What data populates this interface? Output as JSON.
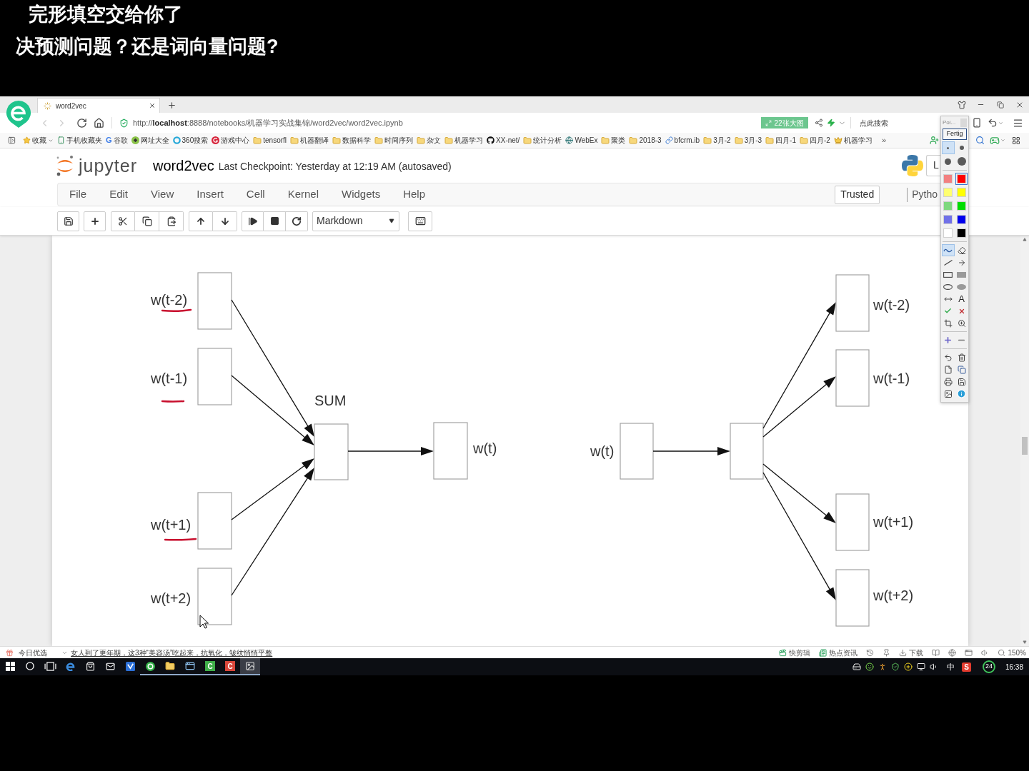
{
  "subtitles": [
    "完形填空交给你了",
    "决预测问题？还是词向量问题?"
  ],
  "browser": {
    "tabs": [
      {
        "title": "word2vec",
        "selected": true
      }
    ],
    "nav": {
      "back": {
        "disabled": true
      },
      "forward": {
        "disabled": true
      }
    },
    "url": "http://**localhost**:8888/notebooks/机器学习实战集锦/word2vec/word2vec.ipynb",
    "image_badge": "22张大图",
    "search": {
      "placeholder": "点此搜索"
    },
    "bookmarks": [
      {
        "label": "收藏",
        "kind": "favorites"
      },
      {
        "label": "手机收藏夹",
        "kind": "mobile"
      },
      {
        "label": "谷歌",
        "kind": "letter",
        "glyph": "G"
      },
      {
        "label": "网址大全",
        "kind": "site"
      },
      {
        "label": "360搜索",
        "kind": "ring"
      },
      {
        "label": "游戏中心",
        "kind": "game"
      },
      {
        "label": "tensorfl",
        "kind": "folder"
      },
      {
        "label": "机器翻译",
        "kind": "folder"
      },
      {
        "label": "数据科学",
        "kind": "folder"
      },
      {
        "label": "时间序列",
        "kind": "folder"
      },
      {
        "label": "杂文",
        "kind": "folder"
      },
      {
        "label": "机器学习",
        "kind": "folder"
      },
      {
        "label": "XX-net/",
        "kind": "github"
      },
      {
        "label": "统计分析",
        "kind": "folder"
      },
      {
        "label": "WebEx",
        "kind": "globe"
      },
      {
        "label": "聚类",
        "kind": "folder"
      },
      {
        "label": "2018-3",
        "kind": "folder"
      },
      {
        "label": "bfcrm.ib",
        "kind": "link"
      },
      {
        "label": "3月-2",
        "kind": "folder"
      },
      {
        "label": "3月-3",
        "kind": "folder"
      },
      {
        "label": "四月-1",
        "kind": "folder"
      },
      {
        "label": "四月-2",
        "kind": "folder"
      },
      {
        "label": "机器学习",
        "kind": "crown"
      }
    ],
    "more_bookmarks": "»"
  },
  "notebook": {
    "logo_text": "jupyter",
    "title": "word2vec",
    "checkpoint": "Last Checkpoint: Yesterday at 12:19 AM (autosaved)",
    "logout_button": "L",
    "menu": [
      "File",
      "Edit",
      "View",
      "Insert",
      "Cell",
      "Kernel",
      "Widgets",
      "Help"
    ],
    "trusted_button": "Trusted",
    "kernel": "Pytho",
    "cell_type": "Markdown",
    "diagram": {
      "left_network": {
        "inputs": [
          {
            "label": "w(t-2)",
            "underlined": true
          },
          {
            "label": "w(t-1)",
            "underlined": true
          },
          {
            "label": "w(t+1)",
            "underlined": true
          },
          {
            "label": "w(t+2)",
            "underlined": false
          }
        ],
        "sum_label": "SUM",
        "output_label": "w(t)"
      },
      "right_network": {
        "input_label": "w(t)",
        "outputs": [
          "w(t-2)",
          "w(t-1)",
          "w(t+1)",
          "w(t+2)"
        ]
      }
    }
  },
  "status_bar": {
    "picks_label": "今日优选",
    "headline": "女人到了更年期，这3种“美容汤”吃起来，抗氧化，皱纹悄悄平整",
    "right": [
      {
        "kind": "clip",
        "label": "快剪辑"
      },
      {
        "kind": "news",
        "label": "热点资讯"
      },
      {
        "kind": "history"
      },
      {
        "kind": "pin"
      },
      {
        "kind": "download",
        "label": "下载"
      },
      {
        "kind": "reader"
      },
      {
        "kind": "ie"
      },
      {
        "kind": "window"
      },
      {
        "kind": "sound"
      },
      {
        "kind": "zoom",
        "label": "150%"
      }
    ]
  },
  "taskbar": {
    "apps": [
      {
        "kind": "start",
        "open": false,
        "active": false
      },
      {
        "kind": "search",
        "open": false,
        "active": false
      },
      {
        "kind": "taskview",
        "open": false,
        "active": false
      },
      {
        "kind": "edge",
        "open": false,
        "active": false
      },
      {
        "kind": "store",
        "open": false,
        "active": false
      },
      {
        "kind": "mail",
        "open": false,
        "active": false
      },
      {
        "kind": "bird",
        "open": false,
        "active": false
      },
      {
        "kind": "browser",
        "open": true,
        "active": false
      },
      {
        "kind": "explorer",
        "open": true,
        "active": false
      },
      {
        "kind": "window",
        "open": true,
        "active": false
      },
      {
        "kind": "tile",
        "glyph": "C",
        "color": "#3fae49",
        "open": true,
        "active": false
      },
      {
        "kind": "tile",
        "glyph": "C",
        "color": "#d9473b",
        "open": true,
        "active": false
      },
      {
        "kind": "image",
        "open": true,
        "active": true
      }
    ],
    "tray": [
      {
        "kind": "disk"
      },
      {
        "kind": "smile"
      },
      {
        "kind": "figure"
      },
      {
        "kind": "shield"
      },
      {
        "kind": "plus"
      },
      {
        "kind": "network"
      },
      {
        "kind": "volume"
      }
    ],
    "ime": "中",
    "ime_tile": "S",
    "badge": "24",
    "clock": "16:38"
  },
  "palette": {
    "title": "Poi...",
    "done_button": "Fertig",
    "pen_sizes": [
      {
        "selected": true
      },
      {
        "selected": false
      },
      {
        "selected": false
      },
      {
        "selected": false
      }
    ],
    "colors": [
      {
        "color": "#f28080",
        "selected": false
      },
      {
        "color": "#ff0000",
        "selected": true
      },
      {
        "color": "#ffff70",
        "selected": false
      },
      {
        "color": "#ffff00",
        "selected": false
      },
      {
        "color": "#7ed87e",
        "selected": false
      },
      {
        "color": "#00dd00",
        "selected": false
      },
      {
        "color": "#7070e8",
        "selected": false
      },
      {
        "color": "#0000ee",
        "selected": false
      },
      {
        "color": "#ffffff",
        "selected": false
      },
      {
        "color": "#000000",
        "selected": false
      }
    ],
    "tools": [
      {
        "kind": "freehand",
        "selected": true
      },
      {
        "kind": "eraser",
        "selected": false
      },
      {
        "kind": "line",
        "selected": false
      },
      {
        "kind": "arrow",
        "selected": false
      },
      {
        "kind": "rectangle",
        "selected": false
      },
      {
        "kind": "filled-rectangle",
        "selected": false
      },
      {
        "kind": "ellipse",
        "selected": false
      },
      {
        "kind": "filled-ellipse",
        "selected": false
      },
      {
        "kind": "double-arrow",
        "selected": false
      },
      {
        "kind": "text",
        "glyph": "A",
        "selected": false
      },
      {
        "kind": "check",
        "selected": false
      },
      {
        "kind": "cross",
        "selected": false
      },
      {
        "kind": "crop",
        "selected": false
      },
      {
        "kind": "zoom",
        "selected": false
      }
    ],
    "actions": [
      [
        {
          "kind": "plus"
        },
        {
          "kind": "minus"
        }
      ],
      [
        {
          "kind": "undo"
        },
        {
          "kind": "trash"
        },
        {
          "kind": "page"
        },
        {
          "kind": "copy"
        },
        {
          "kind": "print"
        },
        {
          "kind": "save"
        },
        {
          "kind": "screen"
        },
        {
          "kind": "info"
        }
      ]
    ]
  }
}
